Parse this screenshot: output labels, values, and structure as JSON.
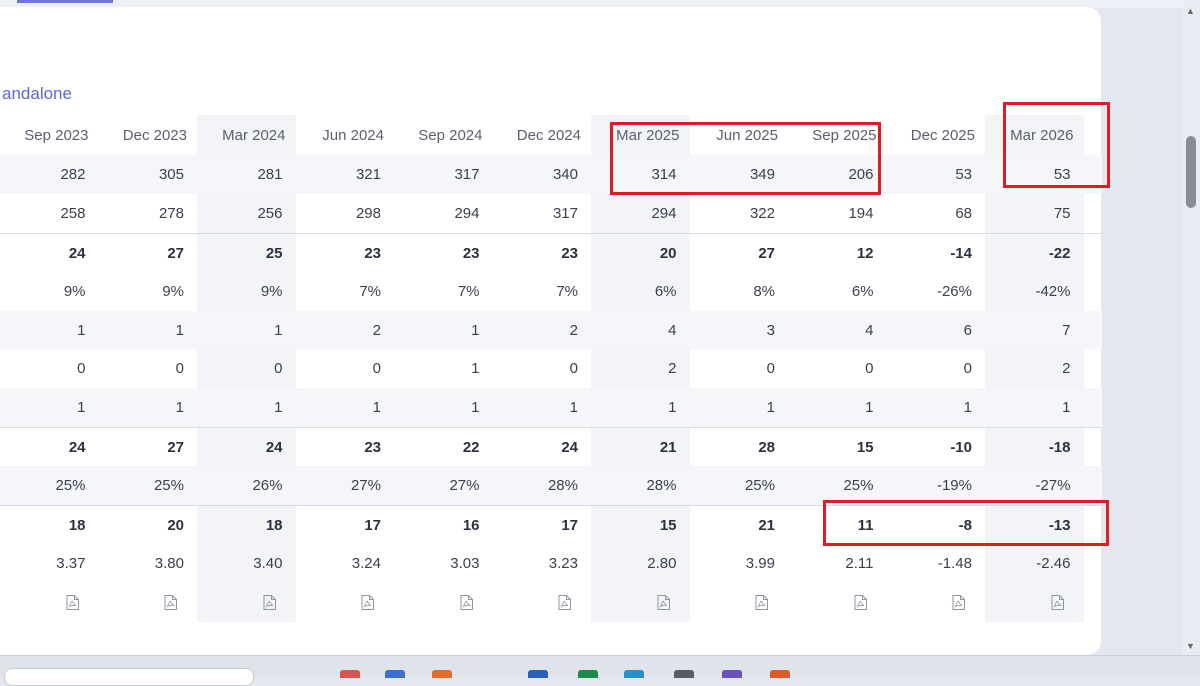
{
  "section": {
    "label": "andalone"
  },
  "columns": [
    "Sep 2023",
    "Dec 2023",
    "Mar 2024",
    "Jun 2024",
    "Sep 2024",
    "Dec 2024",
    "Mar 2025",
    "Jun 2025",
    "Sep 2025",
    "Dec 2025",
    "Mar 2026"
  ],
  "rows": [
    {
      "name": "row-1",
      "bold": false,
      "band": true,
      "values": [
        "282",
        "305",
        "281",
        "321",
        "317",
        "340",
        "314",
        "349",
        "206",
        "53",
        "53"
      ]
    },
    {
      "name": "row-2",
      "bold": false,
      "band": false,
      "values": [
        "258",
        "278",
        "256",
        "298",
        "294",
        "317",
        "294",
        "322",
        "194",
        "68",
        "75"
      ]
    },
    {
      "name": "row-3",
      "bold": true,
      "band": false,
      "values": [
        "24",
        "27",
        "25",
        "23",
        "23",
        "23",
        "20",
        "27",
        "12",
        "-14",
        "-22"
      ]
    },
    {
      "name": "row-4",
      "bold": false,
      "band": false,
      "values": [
        "9%",
        "9%",
        "9%",
        "7%",
        "7%",
        "7%",
        "6%",
        "8%",
        "6%",
        "-26%",
        "-42%"
      ]
    },
    {
      "name": "row-5",
      "bold": false,
      "band": true,
      "values": [
        "1",
        "1",
        "1",
        "2",
        "1",
        "2",
        "4",
        "3",
        "4",
        "6",
        "7"
      ]
    },
    {
      "name": "row-6",
      "bold": false,
      "band": false,
      "values": [
        "0",
        "0",
        "0",
        "0",
        "1",
        "0",
        "2",
        "0",
        "0",
        "0",
        "2"
      ]
    },
    {
      "name": "row-7",
      "bold": false,
      "band": true,
      "values": [
        "1",
        "1",
        "1",
        "1",
        "1",
        "1",
        "1",
        "1",
        "1",
        "1",
        "1"
      ]
    },
    {
      "name": "row-8",
      "bold": true,
      "band": false,
      "values": [
        "24",
        "27",
        "24",
        "23",
        "22",
        "24",
        "21",
        "28",
        "15",
        "-10",
        "-18"
      ]
    },
    {
      "name": "row-9",
      "bold": false,
      "band": true,
      "values": [
        "25%",
        "25%",
        "26%",
        "27%",
        "27%",
        "28%",
        "28%",
        "25%",
        "25%",
        "-19%",
        "-27%"
      ]
    },
    {
      "name": "row-10",
      "bold": true,
      "band": false,
      "values": [
        "18",
        "20",
        "18",
        "17",
        "16",
        "17",
        "15",
        "21",
        "11",
        "-8",
        "-13"
      ]
    },
    {
      "name": "row-11",
      "bold": false,
      "band": false,
      "values": [
        "3.37",
        "3.80",
        "3.40",
        "3.24",
        "3.03",
        "3.23",
        "2.80",
        "3.99",
        "2.11",
        "-1.48",
        "-2.46"
      ]
    }
  ],
  "report_icon": "pdf-file-icon",
  "colors": {
    "accent": "#5b66e0",
    "highlight": "#e01b24"
  }
}
